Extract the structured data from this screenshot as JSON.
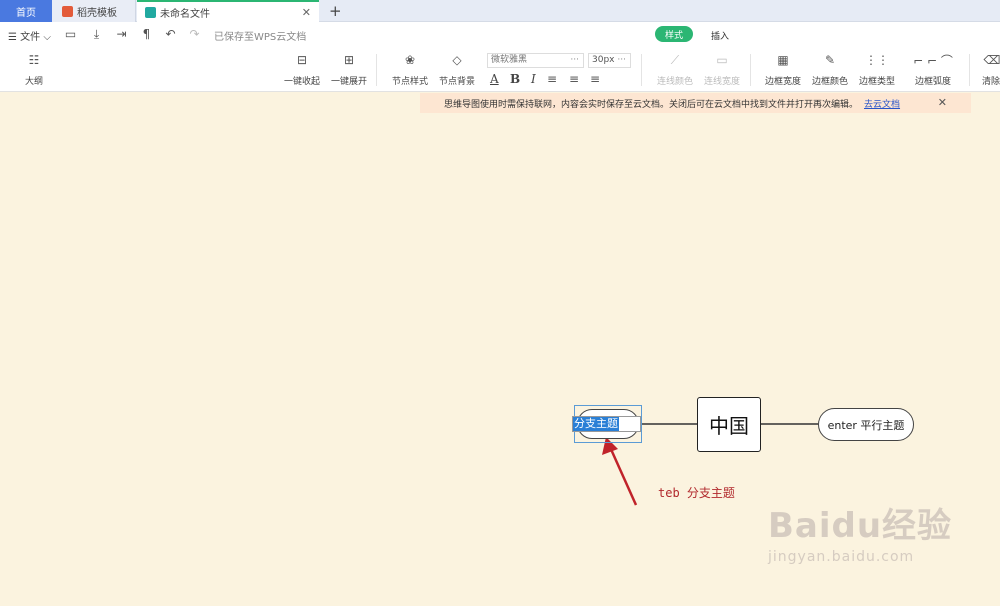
{
  "tabs": {
    "home": "首页",
    "templates": "稻壳模板",
    "file": "未命名文件"
  },
  "toolbar": {
    "file_menu": "文件",
    "saved_status": "已保存至WPS云文档",
    "mode_style": "样式",
    "mode_insert": "插入"
  },
  "tools": {
    "outline": "大纲",
    "collapse_all": "一键收起",
    "expand_all": "一键展开",
    "node_style": "节点样式",
    "node_bg": "节点背景",
    "font_name": "微软雅黑",
    "font_size": "30px",
    "line_color": "连线颜色",
    "line_width": "连线宽度",
    "border_width": "边框宽度",
    "border_color": "边框颜色",
    "border_type": "边框类型",
    "border_radius": "边框弧度",
    "clear": "清除"
  },
  "notice": {
    "text": "思维导图使用时需保持联网，内容会实时保存至云文档。关闭后可在云文档中找到文件并打开再次编辑。",
    "link": "去云文档"
  },
  "mindmap": {
    "root": "中国",
    "branch": "分支主题",
    "sibling": "enter 平行主题",
    "annotation": "teb 分支主题"
  },
  "watermark": {
    "main": "Baidu经验",
    "sub": "jingyan.baidu.com"
  },
  "colors": {
    "accent": "#2bb673",
    "home_tab": "#4a79e0",
    "canvas": "#fbf3df",
    "annotation": "#b1282c"
  }
}
